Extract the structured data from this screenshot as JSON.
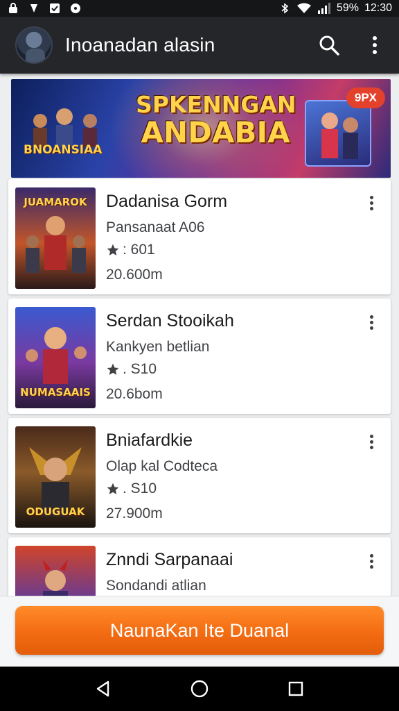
{
  "status_bar": {
    "battery": "59%",
    "time": "12:30"
  },
  "app_bar": {
    "title": "Inoanadan alasin",
    "icons": [
      "avatar",
      "search-icon",
      "more-vert-icon"
    ]
  },
  "banner": {
    "title_line1": "SPKENNGAN",
    "title_line2": "ANDABIA",
    "logo_text": "BNOANSIAA",
    "badge": "9PX"
  },
  "games": [
    {
      "title": "Dadanisa Gorm",
      "subtitle": "Pansanaat A06",
      "rating": ": 601",
      "size": "20.600m",
      "thumb_label": "JUAMAROK"
    },
    {
      "title": "Serdan Stooikah",
      "subtitle": "Kankyen betlian",
      "rating": ". S10",
      "size": "20.6bom",
      "thumb_label": "NUMASAAIS"
    },
    {
      "title": "Bniafardkie",
      "subtitle": "Olap kal Codteca",
      "rating": ". S10",
      "size": "27.900m",
      "thumb_label": "ODUGUAK"
    },
    {
      "title": "Znndi Sarpanaai",
      "subtitle": "Sondandi atlian",
      "rating": "",
      "size": "",
      "thumb_label": ""
    }
  ],
  "cta": {
    "label": "NaunaKan Ite Duanal"
  },
  "colors": {
    "cta": "#f36c12",
    "app_bar": "#242629",
    "status_bar": "#151617"
  }
}
